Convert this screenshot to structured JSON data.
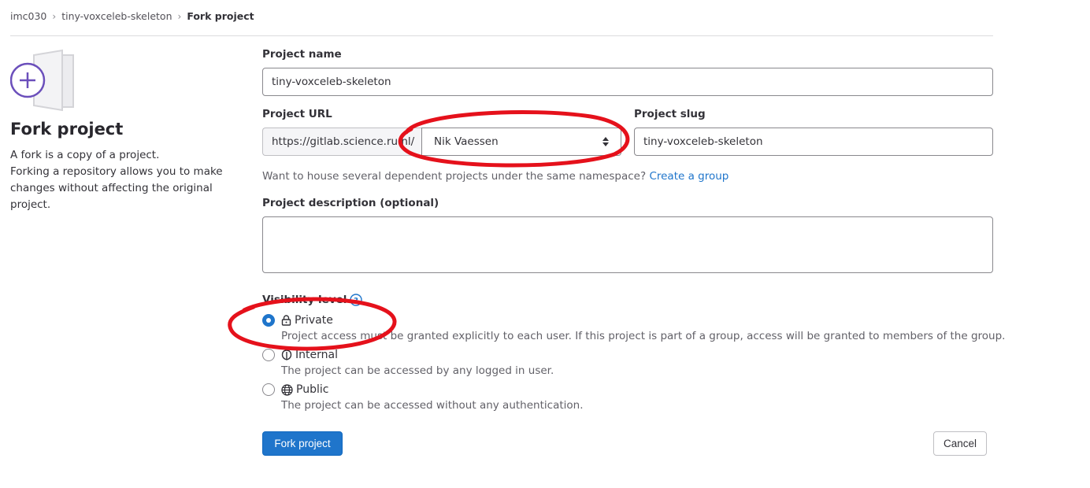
{
  "breadcrumb": {
    "items": [
      "imc030",
      "tiny-voxceleb-skeleton"
    ],
    "current": "Fork project"
  },
  "sidebar": {
    "title": "Fork project",
    "description_lines": [
      "A fork is a copy of a project.",
      "Forking a repository allows you to make",
      "changes without affecting the original",
      "project."
    ]
  },
  "form": {
    "project_name": {
      "label": "Project name",
      "value": "tiny-voxceleb-skeleton"
    },
    "project_url": {
      "label": "Project URL",
      "prefix": "https://gitlab.science.ru.nl/",
      "namespace_selected": "Nik Vaessen"
    },
    "project_slug": {
      "label": "Project slug",
      "value": "tiny-voxceleb-skeleton"
    },
    "namespace_hint": {
      "text": "Want to house several dependent projects under the same namespace?",
      "link": "Create a group"
    },
    "description": {
      "label": "Project description (optional)",
      "value": ""
    },
    "visibility": {
      "label": "Visibility level",
      "options": [
        {
          "label": "Private",
          "icon": "lock-icon",
          "help": "Project access must be granted explicitly to each user. If this project is part of a group, access will be granted to members of the group.",
          "checked": true
        },
        {
          "label": "Internal",
          "icon": "shield-icon",
          "help": "The project can be accessed by any logged in user.",
          "checked": false
        },
        {
          "label": "Public",
          "icon": "earth-icon",
          "help": "The project can be accessed without any authentication.",
          "checked": false
        }
      ]
    },
    "submit_label": "Fork project",
    "cancel_label": "Cancel"
  },
  "colors": {
    "primary": "#1f75cb",
    "illustration_accent": "#6b4fbb",
    "annotation_red": "#e5111b"
  }
}
